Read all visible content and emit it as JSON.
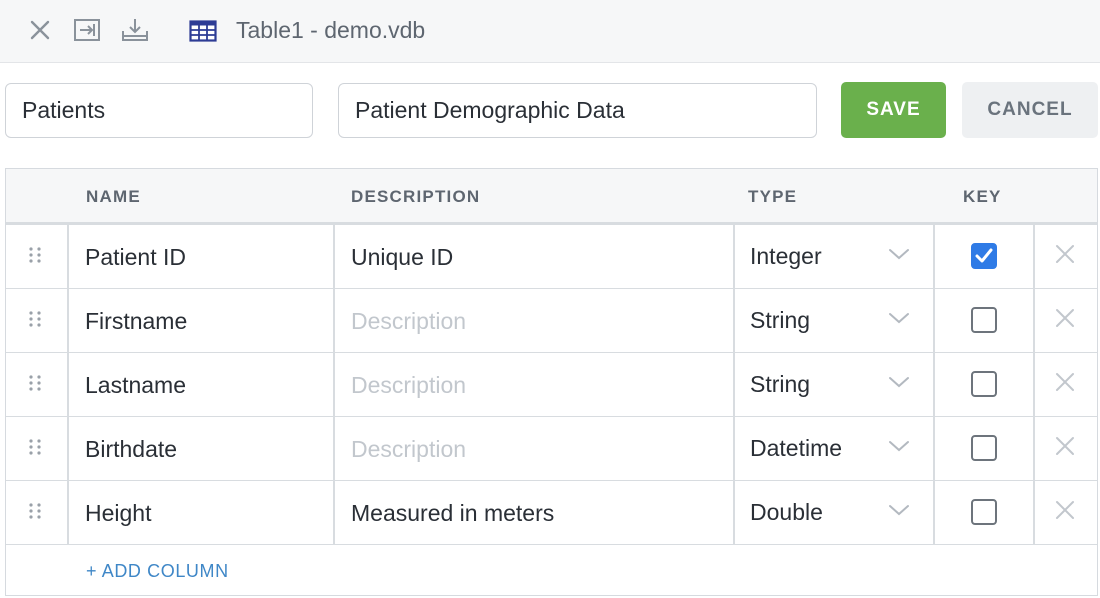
{
  "toolbar": {
    "close_icon": "close-icon",
    "collapse_icon": "collapse-right-icon",
    "download_icon": "download-icon",
    "table_icon": "table-icon",
    "title": "Table1 - demo.vdb"
  },
  "form": {
    "name_value": "Patients",
    "description_value": "Patient Demographic Data",
    "save_label": "SAVE",
    "cancel_label": "CANCEL"
  },
  "table": {
    "headers": {
      "name": "NAME",
      "description": "DESCRIPTION",
      "type": "TYPE",
      "key": "KEY"
    },
    "rows": [
      {
        "name": "Patient ID",
        "description": "Unique ID",
        "type": "Integer",
        "key": true
      },
      {
        "name": "Firstname",
        "description": "",
        "type": "String",
        "key": false
      },
      {
        "name": "Lastname",
        "description": "",
        "type": "String",
        "key": false
      },
      {
        "name": "Birthdate",
        "description": "",
        "type": "Datetime",
        "key": false
      },
      {
        "name": "Height",
        "description": "Measured in meters",
        "type": "Double",
        "key": false
      }
    ],
    "description_placeholder": "Description",
    "add_column_label": "+ ADD COLUMN"
  },
  "colors": {
    "save": "#6ab04c",
    "checked": "#2f7be6",
    "link": "#3f87c7"
  }
}
